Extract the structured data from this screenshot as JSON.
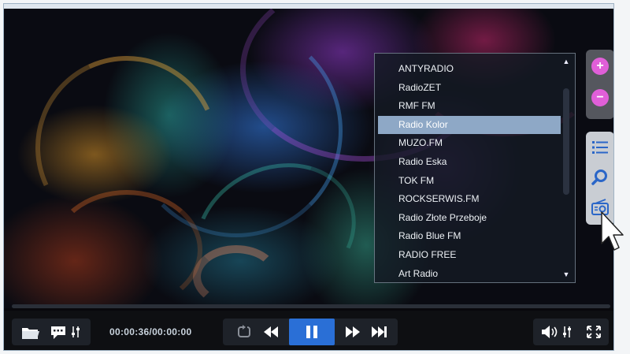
{
  "player": {
    "stations": [
      {
        "label": "ANTYRADIO"
      },
      {
        "label": "RadioZET"
      },
      {
        "label": "RMF FM"
      },
      {
        "label": "Radio Kolor"
      },
      {
        "label": "MUZO.FM"
      },
      {
        "label": "Radio Eska"
      },
      {
        "label": "TOK FM"
      },
      {
        "label": "ROCKSERWIS.FM"
      },
      {
        "label": "Radio Złote Przeboje"
      },
      {
        "label": "Radio Blue FM"
      },
      {
        "label": "RADIO FREE"
      },
      {
        "label": "Art Radio"
      }
    ],
    "selected_station": "Radio Kolor",
    "zoom_in_label": "+",
    "zoom_out_label": "−",
    "time_display": "00:00:36/00:00:00",
    "progress_fraction": 0.0,
    "accent_color": "#e05fd8",
    "selection_color": "#8ea8c6",
    "play_button_color": "#2a6fd6"
  }
}
